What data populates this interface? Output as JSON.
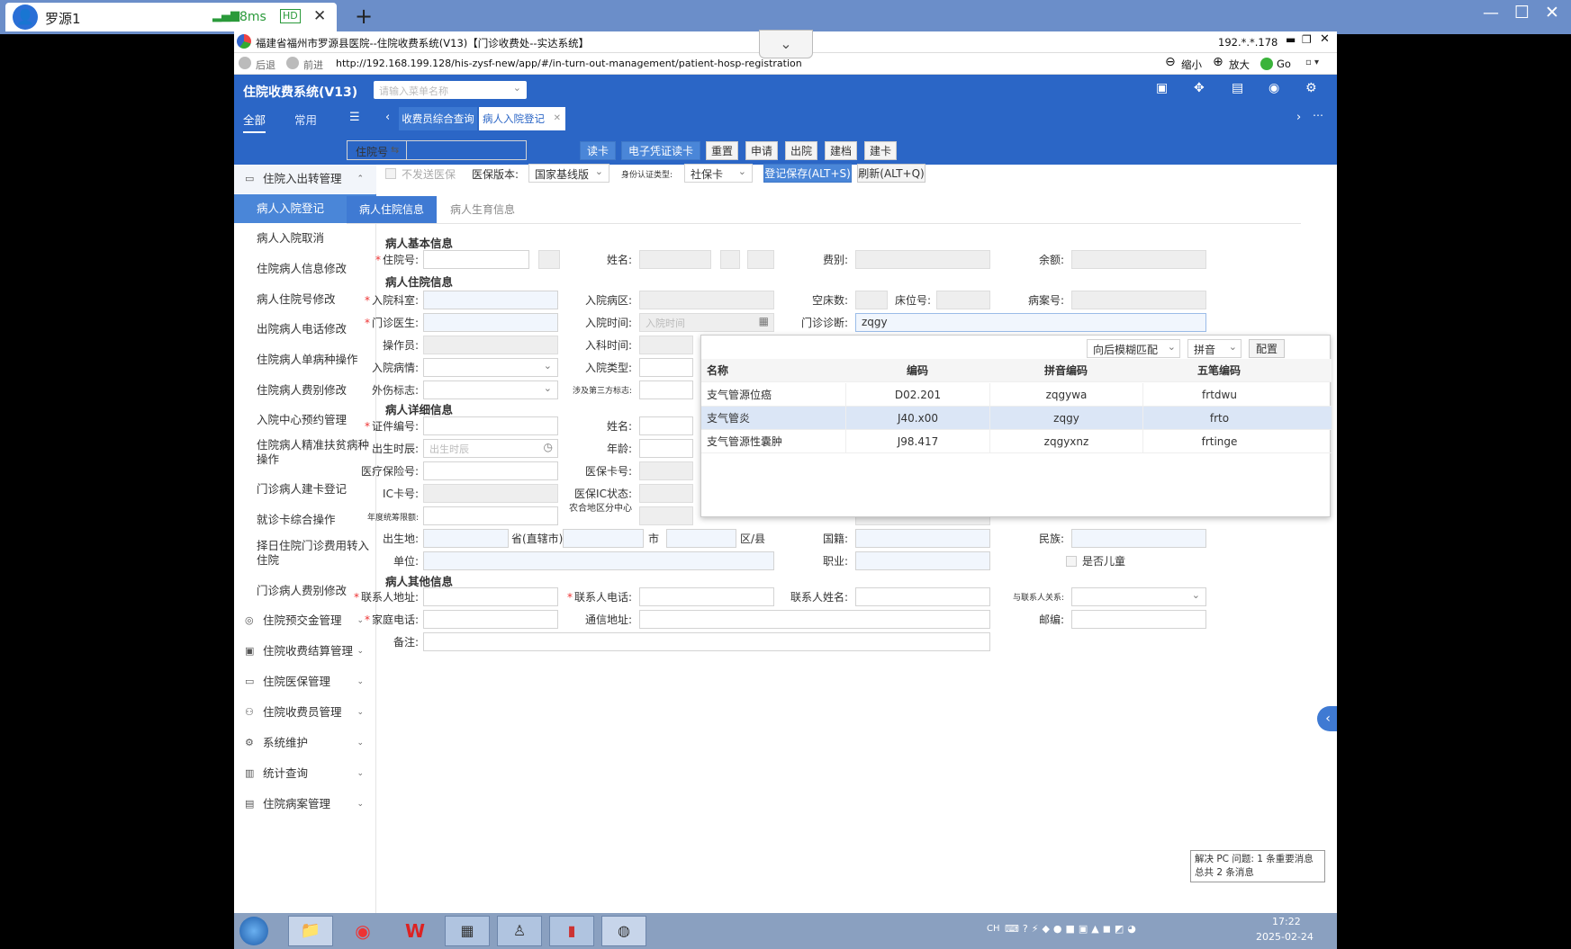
{
  "outer": {
    "tab_title": "罗源1",
    "latency": "8ms",
    "hd": "HD",
    "close": "✕",
    "new_tab": "+",
    "win_min": "—",
    "win_max": "☐",
    "win_close": "✕"
  },
  "browser": {
    "title": "福建省福州市罗源县医院--住院收费系统(V13)【门诊收费处--实达系统】",
    "ip": "192.*.*.178",
    "back": "后退",
    "forward": "前进",
    "url": "http://192.168.199.128/his-zysf-new/app/#/in-turn-out-management/patient-hosp-registration",
    "zoom_out": "缩小",
    "zoom_in": "放大",
    "go": "Go"
  },
  "app": {
    "title": "住院收费系统(V13)",
    "search_placeholder": "请输入菜单名称",
    "nav_all": "全部",
    "nav_common": "常用",
    "tabs": [
      {
        "label": "收费员综合查询"
      },
      {
        "label": "病人入院登记"
      }
    ]
  },
  "sidebar": {
    "group_top": "住院入出转管理",
    "items": [
      "病人入院登记",
      "病人入院取消",
      "住院病人信息修改",
      "病人住院号修改",
      "出院病人电话修改",
      "住院病人单病种操作",
      "住院病人费别修改",
      "入院中心预约管理",
      "住院病人精准扶贫病种操作",
      "门诊病人建卡登记",
      "就诊卡综合操作",
      "择日住院门诊费用转入住院",
      "门诊病人费别修改"
    ],
    "groups": [
      "住院预交金管理",
      "住院收费结算管理",
      "住院医保管理",
      "住院收费员管理",
      "系统维护",
      "统计查询",
      "住院病案管理"
    ]
  },
  "toolbar": {
    "hosp_no_label": "住院号",
    "read_card": "读卡",
    "e_voucher": "电子凭证读卡",
    "reset": "重置",
    "apply": "申请",
    "discharge": "出院",
    "archive": "建档",
    "build_card": "建卡",
    "no_insurance": "不发送医保",
    "insurance_version_label": "医保版本:",
    "insurance_version_value": "国家基线版",
    "id_type_label": "身份认证类型:",
    "id_type_value": "社保卡",
    "save": "登记保存(ALT+S)",
    "refresh": "刷新(ALT+Q)"
  },
  "subtabs": {
    "active": "病人住院信息",
    "other": "病人生育信息"
  },
  "form": {
    "sec_basic": "病人基本信息",
    "sec_hosp": "病人住院信息",
    "sec_detail": "病人详细信息",
    "sec_other": "病人其他信息",
    "hosp_no": "住院号",
    "name": "姓名",
    "fee_type": "费别",
    "balance": "余额",
    "dept": "入院科室",
    "ward": "入院病区",
    "empty_beds": "空床数",
    "bed_no": "床位号",
    "room_no": "病案号",
    "doctor": "门诊医生",
    "admit_time": "入院时间",
    "admit_time_placeholder": "入院时间",
    "op_diag": "门诊诊断",
    "op_diag_value": "zqgy",
    "operator": "操作员",
    "dept_time": "入科时间",
    "admit_cond": "入院病情",
    "admit_type": "入院类型",
    "injury": "外伤标志",
    "third_party": "涉及第三方标志",
    "id_no": "证件编号",
    "name2": "姓名",
    "birth": "出生时辰",
    "birth_placeholder": "出生时辰",
    "age": "年龄",
    "med_ins_no": "医疗保险号",
    "ins_card_no": "医保卡号",
    "ic_no": "IC卡号",
    "ins_ic_status": "医保IC状态",
    "annual_total": "年度统筹限额",
    "rural_area": "农合地区分中心",
    "birthplace": "出生地",
    "province": "省(直辖市)",
    "city": "市",
    "district": "区/县",
    "nationality": "国籍",
    "ethnicity": "民族",
    "unit": "单位",
    "occupation": "职业",
    "is_child": "是否儿童",
    "contact_addr": "联系人地址",
    "contact_phone": "联系人电话",
    "contact_name": "联系人姓名",
    "contact_relation": "与联系人关系",
    "home_phone": "家庭电话",
    "mail_addr": "通信地址",
    "postcode": "邮编",
    "remark": "备注"
  },
  "dropdown": {
    "match_mode": "向后模糊匹配",
    "input_mode": "拼音",
    "config": "配置",
    "headers": [
      "名称",
      "编码",
      "拼音编码",
      "五笔编码"
    ],
    "rows": [
      [
        "支气管源位癌",
        "D02.201",
        "zqgywa",
        "frtdwu"
      ],
      [
        "支气管炎",
        "J40.x00",
        "zqgy",
        "frto"
      ],
      [
        "支气管源性囊肿",
        "J98.417",
        "zqgyxnz",
        "frtinge"
      ]
    ]
  },
  "notification": {
    "line1": "解决 PC 问题: 1 条重要消息",
    "line2": "总共 2 条消息"
  },
  "taskbar": {
    "ime": "CH",
    "time": "17:22",
    "date": "2025-02-24"
  }
}
